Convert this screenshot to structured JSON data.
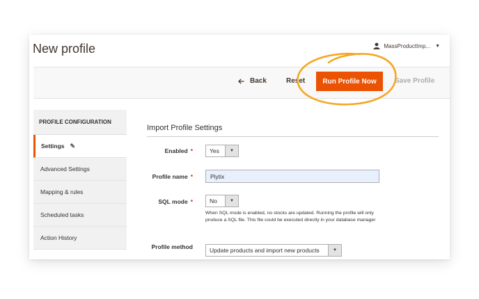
{
  "page": {
    "title": "New profile"
  },
  "user": {
    "name": "MassProductImp..."
  },
  "actions": {
    "back": "Back",
    "reset": "Reset",
    "run": "Run Profile Now",
    "save": "Save Profile"
  },
  "colors": {
    "accent": "#eb5202",
    "highlight_ring": "#f5a623"
  },
  "sidebar": {
    "heading": "PROFILE CONFIGURATION",
    "items": [
      {
        "label": "Settings",
        "active": true
      },
      {
        "label": "Advanced Settings"
      },
      {
        "label": "Mapping & rules"
      },
      {
        "label": "Scheduled tasks"
      },
      {
        "label": "Action History"
      }
    ]
  },
  "section": {
    "title": "Import Profile Settings"
  },
  "form": {
    "enabled": {
      "label": "Enabled",
      "value": "Yes"
    },
    "profile_name": {
      "label": "Profile name",
      "value": "Plytix"
    },
    "sql_mode": {
      "label": "SQL mode",
      "value": "No",
      "note": "When SQL mode is enabled, no stocks are updated. Running the profile will only produce a SQL file. This file could be executed directly in your database manager"
    },
    "profile_method": {
      "label": "Profile method",
      "value": "Update products and import new products"
    }
  }
}
